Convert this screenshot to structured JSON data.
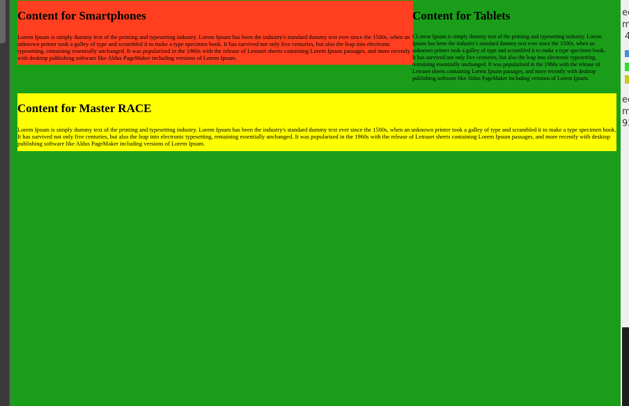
{
  "sections": {
    "smartphones": {
      "title": "Content for Smartphones",
      "body": "Lorem Ipsum is simply dummy text of the printing and typesetting industry. Lorem Ipsum has been the industry's standard dummy text ever since the 1500s, when an unknown printer took a galley of type and scrambled it to make a type specimen book. It has survived not only five centuries, but also the leap into electronic typesetting, remaining essentially unchanged. It was popularised in the 1960s with the release of Letraset sheets containing Lorem Ipsum passages, and more recently with desktop publishing software like Aldus PageMaker including versions of Lorem Ipsum.",
      "color": "#ff3f1f"
    },
    "tablets": {
      "title": "Content for Tablets",
      "body": "CLorem Ipsum is simply dummy text of the printing and typesetting industry. Lorem Ipsum has been the industry's standard dummy text ever since the 1500s, when an unknown printer took a galley of type and scrambled it to make a type specimen book. It has survived not only five centuries, but also the leap into electronic typesetting, remaining essentially unchanged. It was popularised in the 1960s with the release of Letraset sheets containing Lorem Ipsum passages, and more recently with desktop publishing software like Aldus PageMaker including versions of Lorem Ipsum."
    },
    "master_race": {
      "title": "Content for Master RACE",
      "body": "Lorem Ipsum is simply dummy text of the printing and typesetting industry. Lorem Ipsum has been the industry's standard dummy text ever since the 1500s, when an unknown printer took a galley of type and scrambled it to make a type specimen book. It has survived not only five centuries, but also the leap into electronic typesetting, remaining essentially unchanged. It was popularised in the 1960s with the release of Letraset sheets containing Lorem Ipsum passages, and more recently with desktop publishing software like Aldus PageMaker including versions of Lorem Ipsum.",
      "color": "#ffff00"
    }
  },
  "page_background": "#1a9e1a",
  "right_panel_fragments": [
    "ee",
    "m",
    "4",
    "ee",
    "m",
    "92"
  ]
}
